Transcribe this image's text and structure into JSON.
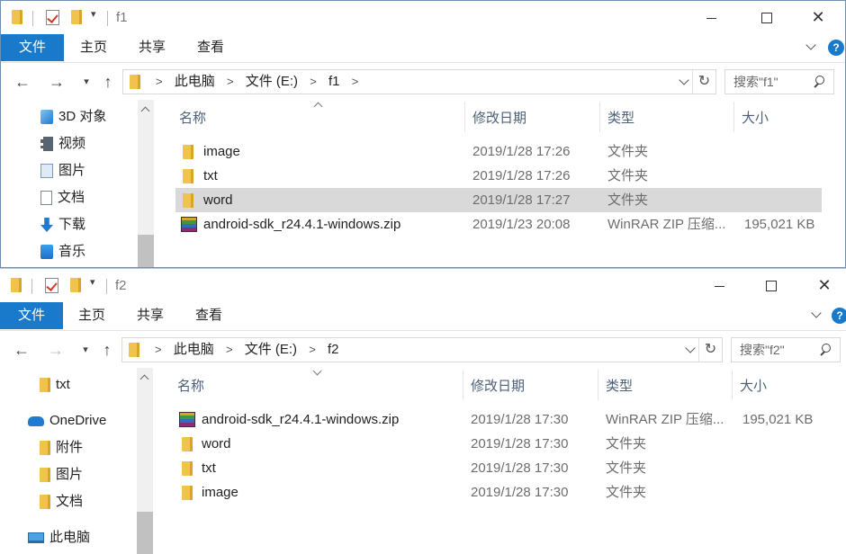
{
  "colors": {
    "accent": "#1979ca",
    "folder": "#f0c44c",
    "selected_row": "#d9d9d9"
  },
  "icons": [
    "folder-icon",
    "properties-check-icon",
    "quick-access-dropdown-icon",
    "minimize-icon",
    "maximize-icon",
    "close-icon",
    "ribbon-expand-icon",
    "help-icon",
    "back-arrow-icon",
    "forward-arrow-icon",
    "recent-locations-icon",
    "up-arrow-icon",
    "refresh-icon",
    "search-icon",
    "3d-objects-icon",
    "video-icon",
    "pictures-icon",
    "documents-icon",
    "downloads-icon",
    "music-icon",
    "onedrive-icon",
    "this-pc-icon",
    "zip-archive-icon"
  ],
  "window1": {
    "title": "f1",
    "ribbon_tabs": [
      "文件",
      "主页",
      "共享",
      "查看"
    ],
    "breadcrumb": [
      "此电脑",
      "文件 (E:)",
      "f1"
    ],
    "search_placeholder": "搜索\"f1\"",
    "nav_items": [
      "3D 对象",
      "视频",
      "图片",
      "文档",
      "下载",
      "音乐"
    ],
    "columns": {
      "name": "名称",
      "modified": "修改日期",
      "type": "类型",
      "size": "大小"
    },
    "files": [
      {
        "name": "image",
        "modified": "2019/1/28 17:26",
        "type": "文件夹",
        "size": ""
      },
      {
        "name": "txt",
        "modified": "2019/1/28 17:26",
        "type": "文件夹",
        "size": ""
      },
      {
        "name": "word",
        "modified": "2019/1/28 17:27",
        "type": "文件夹",
        "size": ""
      },
      {
        "name": "android-sdk_r24.4.1-windows.zip",
        "modified": "2019/1/23 20:08",
        "type": "WinRAR ZIP 压缩...",
        "size": "195,021 KB"
      }
    ]
  },
  "window2": {
    "title": "f2",
    "ribbon_tabs": [
      "文件",
      "主页",
      "共享",
      "查看"
    ],
    "breadcrumb": [
      "此电脑",
      "文件 (E:)",
      "f2"
    ],
    "search_placeholder": "搜索\"f2\"",
    "nav_items": [
      "txt",
      "OneDrive",
      "附件",
      "图片",
      "文档",
      "此电脑"
    ],
    "columns": {
      "name": "名称",
      "modified": "修改日期",
      "type": "类型",
      "size": "大小"
    },
    "files": [
      {
        "name": "android-sdk_r24.4.1-windows.zip",
        "modified": "2019/1/28 17:30",
        "type": "WinRAR ZIP 压缩...",
        "size": "195,021 KB"
      },
      {
        "name": "word",
        "modified": "2019/1/28 17:30",
        "type": "文件夹",
        "size": ""
      },
      {
        "name": "txt",
        "modified": "2019/1/28 17:30",
        "type": "文件夹",
        "size": ""
      },
      {
        "name": "image",
        "modified": "2019/1/28 17:30",
        "type": "文件夹",
        "size": ""
      }
    ]
  }
}
